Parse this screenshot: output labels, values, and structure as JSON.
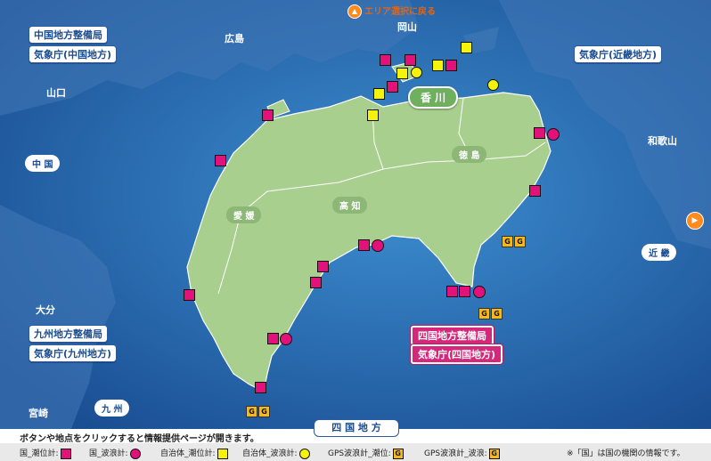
{
  "nav": {
    "back_label": "エリア選択に戻る"
  },
  "regions": {
    "hiroshima": "広島",
    "okayama": "岡山",
    "yamaguchi": "山口",
    "chugoku": "中 国",
    "wakayama": "和歌山",
    "kinki": "近 畿",
    "oita": "大分",
    "kyushu": "九 州",
    "miyazaki": "宮崎",
    "kagawa": "香 川",
    "tokushima": "徳 島",
    "kochi": "高 知",
    "ehime": "愛 媛",
    "shikoku": "四 国 地 方"
  },
  "buttons": {
    "chugoku_bureau": "中国地方整備局",
    "jma_chugoku": "気象庁(中国地方)",
    "jma_kinki": "気象庁(近畿地方)",
    "kyushu_bureau": "九州地方整備局",
    "jma_kyushu": "気象庁(九州地方)",
    "shikoku_bureau": "四国地方整備局",
    "jma_shikoku": "気象庁(四国地方)"
  },
  "gps_letter": "G",
  "note": "ボタンや地点をクリックすると情報提供ページが開きます。",
  "legend": {
    "kuni_tide": "国_潮位計:",
    "kuni_wave": "国_波浪計:",
    "local_tide": "自治体_潮位計:",
    "local_wave": "自治体_波浪計:",
    "gps_tide": "GPS波浪計_潮位:",
    "gps_wave": "GPS波浪計_波浪:",
    "footnote": "※「国」は国の機関の情報です。"
  },
  "colors": {
    "sea": "#1f5aa3",
    "land": "#a8cf8e",
    "kuni": "#e3127b",
    "local": "#f5f20c",
    "gps": "#f6b81a"
  }
}
